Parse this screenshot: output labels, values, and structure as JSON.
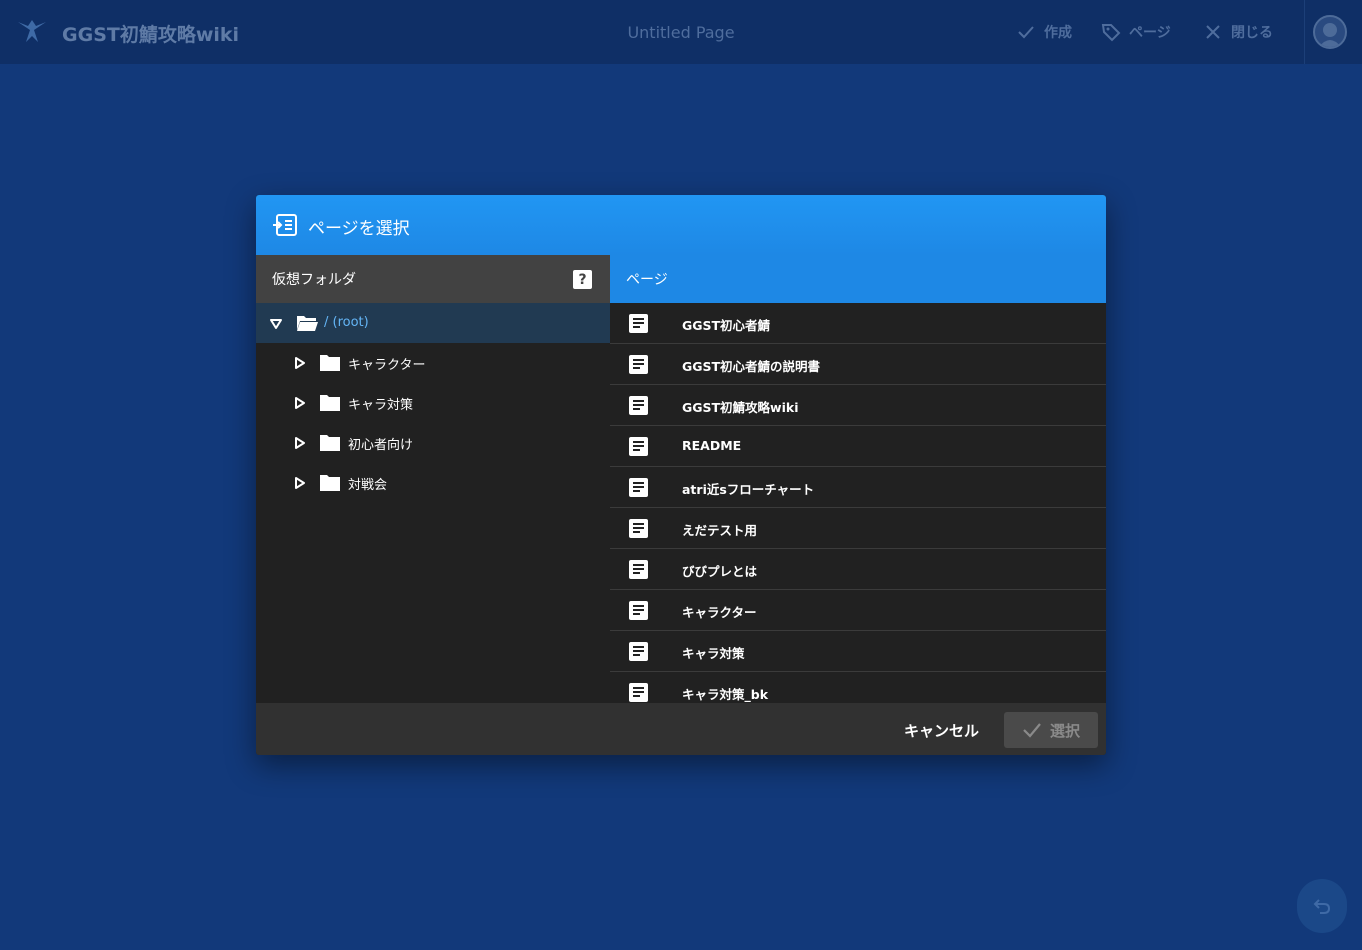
{
  "topbar": {
    "site_title": "GGST初鯖攻略wiki",
    "page_title": "Untitled Page",
    "actions": [
      {
        "label": "作成",
        "icon": "check-icon"
      },
      {
        "label": "ページ",
        "icon": "tag-icon"
      },
      {
        "label": "閉じる",
        "icon": "close-icon"
      }
    ]
  },
  "dialog": {
    "title": "ページを選択",
    "folders_header": "仮想フォルダ",
    "help_label": "?",
    "pages_header": "ページ",
    "root_label": "/ (root)",
    "folders": [
      "キャラクター",
      "キャラ対策",
      "初心者向け",
      "対戦会"
    ],
    "pages": [
      "GGST初心者鯖",
      "GGST初心者鯖の説明書",
      "GGST初鯖攻略wiki",
      "README",
      "atri近sフローチャート",
      "えだテスト用",
      "びびプレとは",
      "キャラクター",
      "キャラ対策",
      "キャラ対策_bk"
    ],
    "cancel_label": "キャンセル",
    "select_label": "選択"
  },
  "colors": {
    "background": "#12397a",
    "header_blue": "#2196f3",
    "root_highlight": "#213a52"
  }
}
